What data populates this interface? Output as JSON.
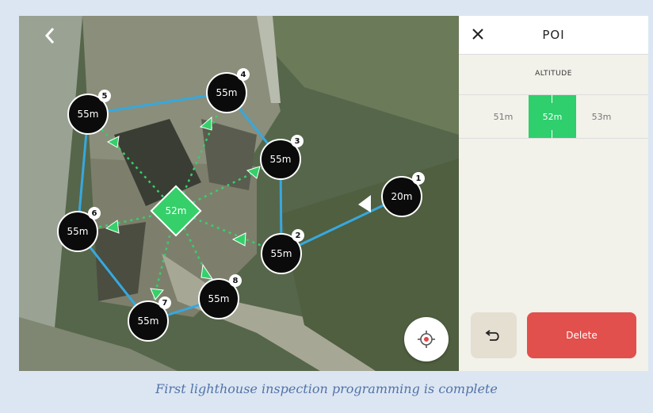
{
  "map": {
    "back_icon": "chevron-left-icon",
    "poi": {
      "label": "52m",
      "color": "#35d06a"
    },
    "waypoints": [
      {
        "number": "1",
        "altitude": "20m"
      },
      {
        "number": "2",
        "altitude": "55m"
      },
      {
        "number": "3",
        "altitude": "55m"
      },
      {
        "number": "4",
        "altitude": "55m"
      },
      {
        "number": "5",
        "altitude": "55m"
      },
      {
        "number": "6",
        "altitude": "55m"
      },
      {
        "number": "7",
        "altitude": "55m"
      },
      {
        "number": "8",
        "altitude": "55m"
      }
    ],
    "route_color": "#37a8de",
    "locate_icon": "target-location-icon"
  },
  "panel": {
    "title": "POI",
    "close_icon": "close-icon",
    "altitude_label": "ALTITUDE",
    "altitude_options": [
      "51m",
      "52m",
      "53m"
    ],
    "selected_altitude": "52m",
    "selected_color": "#2ecf6c",
    "undo_icon": "undo-icon",
    "delete_label": "Delete",
    "delete_color": "#e1504c"
  },
  "caption": "First lighthouse inspection programming is complete"
}
